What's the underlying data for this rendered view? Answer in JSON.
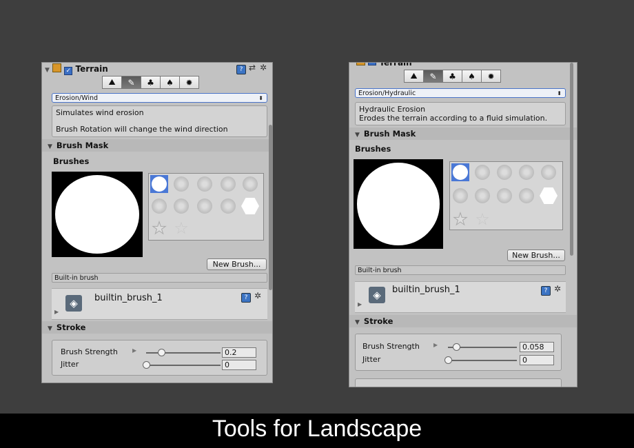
{
  "left": {
    "component_title": "Terrain",
    "tool_mode": "Erosion/Wind",
    "help_line1": "Simulates wind erosion",
    "help_line2": "Brush Rotation will change the wind direction",
    "brush_mask_header": "Brush Mask",
    "brushes_label": "Brushes",
    "new_brush_button": "New Brush...",
    "builtin_label": "Built-in brush",
    "brush_name": "builtin_brush_1",
    "stroke_header": "Stroke",
    "brush_strength_label": "Brush Strength",
    "brush_strength_value": "0.2",
    "brush_strength_fraction": 0.2,
    "jitter_label": "Jitter",
    "jitter_value": "0",
    "jitter_fraction": 0
  },
  "right": {
    "component_title": "Terrain",
    "tool_mode": "Erosion/Hydraulic",
    "help_line1": "Hydraulic Erosion",
    "help_line2": "Erodes the terrain according to a fluid simulation.",
    "brush_mask_header": "Brush Mask",
    "brushes_label": "Brushes",
    "new_brush_button": "New Brush...",
    "builtin_label": "Built-in brush",
    "brush_name": "builtin_brush_1",
    "stroke_header": "Stroke",
    "brush_strength_label": "Brush Strength",
    "brush_strength_value": "0.058",
    "brush_strength_fraction": 0.058,
    "jitter_label": "Jitter",
    "jitter_value": "0",
    "jitter_fraction": 0
  },
  "toolbar_icons": [
    "raise-terrain-icon",
    "paint-brush-icon",
    "tree-icon",
    "grass-detail-icon",
    "gear-icon"
  ],
  "caption": "Tools for Landscape"
}
